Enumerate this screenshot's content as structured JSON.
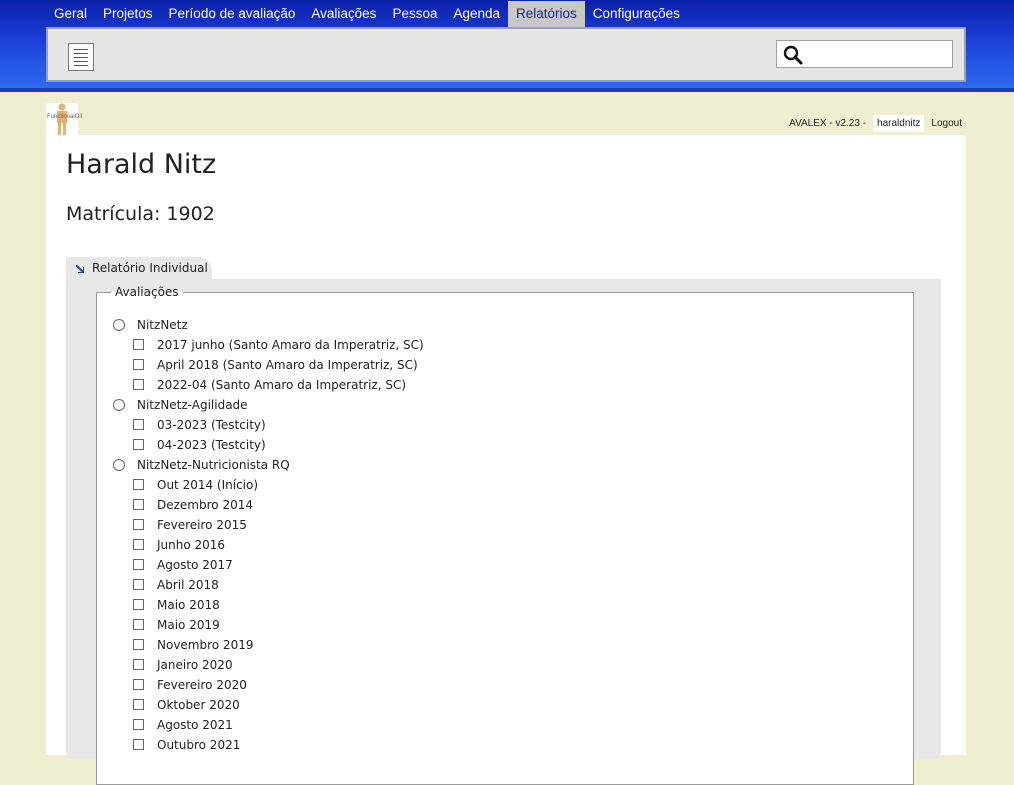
{
  "nav": {
    "items": [
      "Geral",
      "Projetos",
      "Período de avaliação",
      "Avaliações",
      "Pessoa",
      "Agenda",
      "Relatórios",
      "Configurações"
    ],
    "active": "Relatórios"
  },
  "search": {
    "placeholder": ""
  },
  "logo": {
    "text": "FunctionalOil"
  },
  "userbar": {
    "app": "AVALEX - v2.23 -",
    "user": "haraldnitz",
    "logout": "Logout"
  },
  "page": {
    "title": "Harald Nitz",
    "subtitle": "Matrícula: 1902"
  },
  "tab": {
    "label": "Relatório Individual"
  },
  "fieldset": {
    "legend": "Avaliações"
  },
  "groups": [
    {
      "name": "NitzNetz",
      "items": [
        "2017 junho (Santo Amaro da Imperatriz, SC)",
        "April 2018 (Santo Amaro da Imperatriz, SC)",
        "2022-04 (Santo Amaro da Imperatriz, SC)"
      ]
    },
    {
      "name": "NitzNetz-Agilidade",
      "items": [
        "03-2023 (Testcity)",
        "04-2023 (Testcity)"
      ]
    },
    {
      "name": "NitzNetz-Nutricionista RQ",
      "items": [
        "Out 2014 (Início)",
        "Dezembro 2014",
        "Fevereiro 2015",
        "Junho 2016",
        "Agosto 2017",
        "Abril 2018",
        "Maio 2018",
        "Maio 2019",
        "Novembro 2019",
        "Janeiro 2020",
        "Fevereiro 2020",
        "Oktober 2020",
        "Agosto 2021",
        "Outubro 2021"
      ]
    }
  ]
}
